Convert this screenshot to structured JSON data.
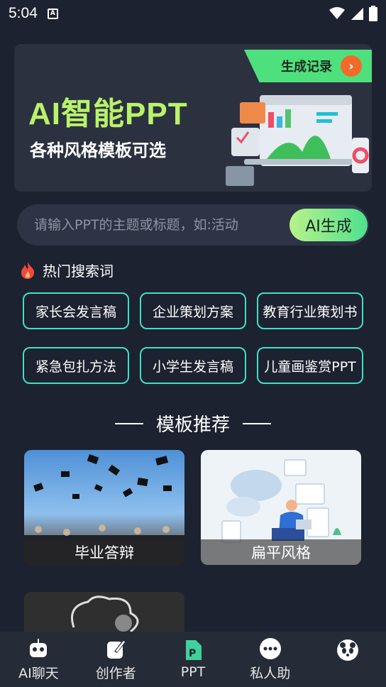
{
  "status_bar": {
    "time": "5:04",
    "a_icon": "A"
  },
  "banner": {
    "title": "AI智能PPT",
    "subtitle": "各种风格模板可选",
    "history_label": "生成记录",
    "history_arrow": "›"
  },
  "search": {
    "placeholder": "请输入PPT的主题或标题，如:活动",
    "button_label": "AI生成"
  },
  "hot": {
    "title": "热门搜索词",
    "chips": [
      "家长会发言稿",
      "企业策划方案",
      "教育行业策划书",
      "紧急包扎方法",
      "小学生发言稿",
      "儿童画鉴赏PPT"
    ]
  },
  "templates": {
    "title": "模板推荐",
    "items": [
      {
        "label": "毕业答辩"
      },
      {
        "label": "扁平风格"
      }
    ]
  },
  "nav": {
    "items": [
      {
        "label": "AI聊天"
      },
      {
        "label": "创作者"
      },
      {
        "label": "PPT"
      },
      {
        "label": "私人助"
      }
    ]
  },
  "colors": {
    "accent_green": "#b9f36a",
    "chip_border": "#3fe0c5",
    "background": "#1d2230"
  }
}
